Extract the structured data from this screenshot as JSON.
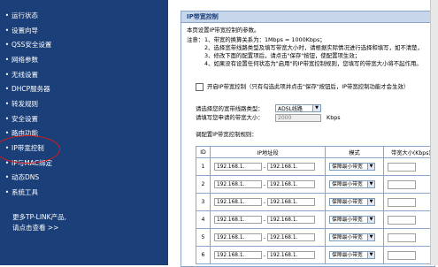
{
  "sidebar": {
    "items": [
      {
        "label": "运行状态"
      },
      {
        "label": "设置向导"
      },
      {
        "label": "QSS安全设置"
      },
      {
        "label": "网络参数"
      },
      {
        "label": "无线设置"
      },
      {
        "label": "DHCP服务器"
      },
      {
        "label": "转发规则"
      },
      {
        "label": "安全设置"
      },
      {
        "label": "路由功能"
      },
      {
        "label": "IP带宽控制"
      },
      {
        "label": "IP与MAC绑定"
      },
      {
        "label": "动态DNS"
      },
      {
        "label": "系统工具"
      }
    ],
    "footer_line1": "更多TP-LINK产品,",
    "footer_line2": "请点击查看 >>",
    "highlight_color": "#d91a1a",
    "background_color": "#1b3f78"
  },
  "panel": {
    "title": "IP带宽控制",
    "intro": "本页设置IP带宽控制的参数。",
    "note_label": "注意：",
    "notes": [
      "1、带宽的换算关系为：1Mbps = 1000Kbps；",
      "2、选择宽带线路类型及填写带宽大小时，请根据实际情况进行选择和填写，如不清楚，",
      "3、修改下面的配置项后，请点击\"保存\"按钮，使配置项生效；",
      "4、如果没有设置任何状态为\"启用\"的IP带宽控制规则，您填写的带宽大小将不起作用。"
    ],
    "enable_label": "开启IP带宽控制（只有勾选此项并点击\"保存\"按钮后，IP带宽控制功能才会生效）",
    "line_type_label": "请选择您的宽带线路类型：",
    "line_type_value": "ADSL线路",
    "bandwidth_label": "请填写您申请的带宽大小：",
    "bandwidth_value": "2000",
    "bandwidth_unit": "Kbps",
    "rules_label": "调配置IP带宽控制规则："
  },
  "table": {
    "headers": [
      "ID",
      "IP地址段",
      "模式",
      "带宽大小(Kbps)"
    ],
    "rows": [
      {
        "id": "1",
        "ip_start": "192.168.1.",
        "ip_end": "192.168.1.",
        "mode": "保障最小带宽"
      },
      {
        "id": "2",
        "ip_start": "192.168.1.",
        "ip_end": "192.168.1.",
        "mode": "保障最小带宽"
      },
      {
        "id": "3",
        "ip_start": "192.168.1.",
        "ip_end": "192.168.1.",
        "mode": "保障最小带宽"
      },
      {
        "id": "4",
        "ip_start": "192.168.1.",
        "ip_end": "192.168.1.",
        "mode": "保障最小带宽"
      },
      {
        "id": "5",
        "ip_start": "192.168.1.",
        "ip_end": "192.168.1.",
        "mode": "保障最小带宽"
      },
      {
        "id": "6",
        "ip_start": "192.168.1.",
        "ip_end": "192.168.1.",
        "mode": "保障最小带宽"
      }
    ],
    "range_separator": "-"
  }
}
